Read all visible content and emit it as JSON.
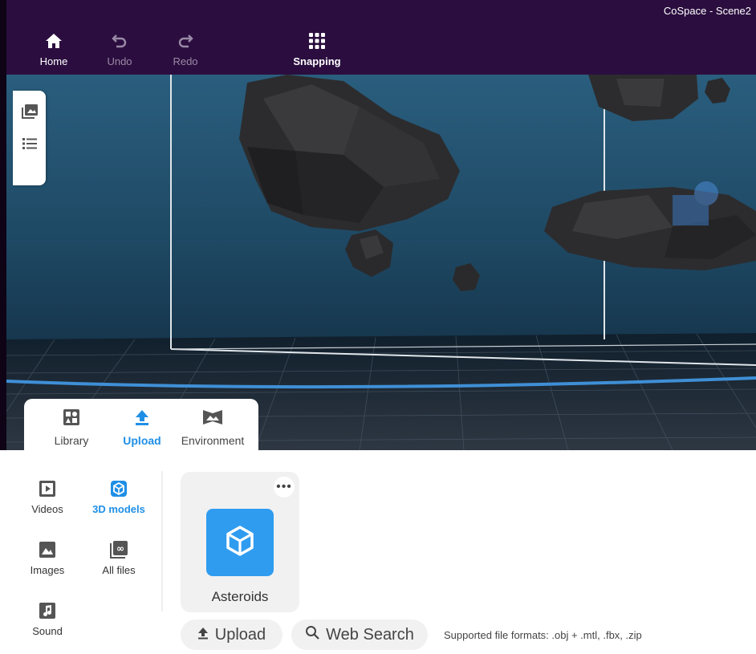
{
  "window": {
    "title": "CoSpace - Scene2"
  },
  "toolbar": {
    "home_label": "Home",
    "undo_label": "Undo",
    "redo_label": "Redo",
    "snapping_label": "Snapping"
  },
  "side_tools": {
    "icons": [
      "gallery-icon",
      "list-icon"
    ]
  },
  "tabs": {
    "library_label": "Library",
    "upload_label": "Upload",
    "environment_label": "Environment",
    "active": "upload"
  },
  "categories": {
    "videos_label": "Videos",
    "models_label": "3D models",
    "images_label": "Images",
    "allfiles_label": "All files",
    "sound_label": "Sound",
    "active": "3d-models"
  },
  "asset_card": {
    "name": "Asteroids",
    "more_label": "•••"
  },
  "actions": {
    "upload_label": "Upload",
    "web_search_label": "Web Search",
    "formats_text": "Supported file formats: .obj + .mtl, .fbx, .zip"
  },
  "colors": {
    "topbar": "#2b0e3f",
    "accent": "#1f8fe6",
    "thumb": "#2f9cf0"
  }
}
